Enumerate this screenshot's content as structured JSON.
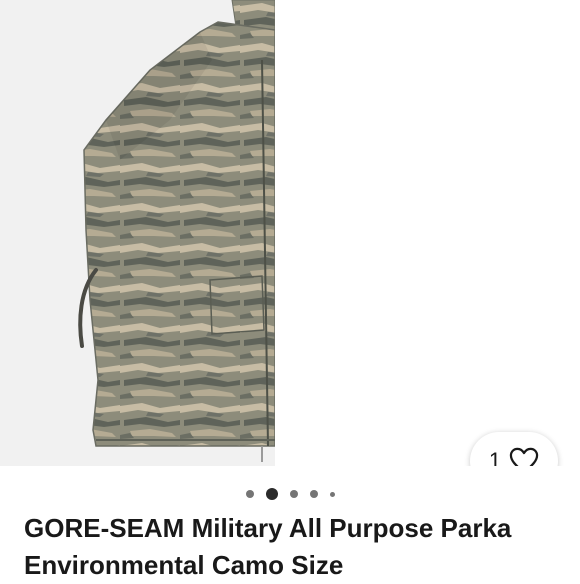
{
  "listing": {
    "title": "GORE-SEAM Military All Purpose Parka Environmental Camo Size",
    "watch_count": "1"
  },
  "gallery": {
    "image_icon": "camo-parka-photo",
    "dots": [
      "inactive",
      "active",
      "inactive",
      "inactive",
      "small"
    ]
  },
  "icons": {
    "watch": "heart-icon"
  },
  "colors": {
    "text": "#191919",
    "dot_active": "#2b2b2b",
    "dot_inactive": "#757575",
    "camo_base": "#8a8a78"
  }
}
